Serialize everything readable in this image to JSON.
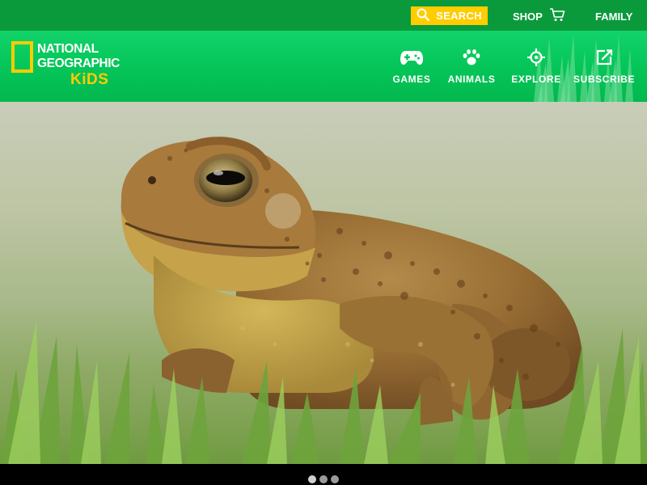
{
  "topbar": {
    "search_label": "SEARCH",
    "shop_label": "SHOP",
    "family_label": "FAMILY"
  },
  "logo": {
    "line1": "NATIONAL",
    "line2": "GEOGRAPHIC",
    "line3": "KiDS"
  },
  "nav": [
    {
      "label": "GAMES",
      "icon": "gamepad-icon"
    },
    {
      "label": "ANIMALS",
      "icon": "paw-icon"
    },
    {
      "label": "EXPLORE",
      "icon": "crosshair-icon"
    },
    {
      "label": "SUBSCRIBE",
      "icon": "edit-icon"
    }
  ],
  "hero": {
    "subject": "toad-photo"
  },
  "carousel": {
    "slide_count": 3,
    "active_index": 0
  },
  "colors": {
    "topbar_green": "#0a9a3c",
    "header_green": "#06c75a",
    "brand_yellow": "#ffcc00",
    "text_white": "#ffffff"
  }
}
